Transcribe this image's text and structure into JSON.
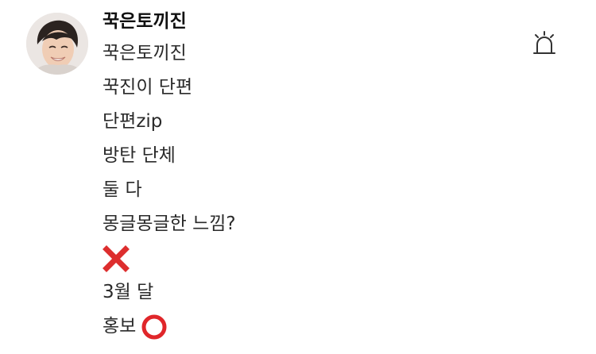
{
  "comment": {
    "username": "꾹은토끼진",
    "lines": [
      {
        "text": "꾹은토끼진"
      },
      {
        "text": "꾹진이 단편"
      },
      {
        "text": "단편zip"
      },
      {
        "text": "방탄 단체"
      },
      {
        "text": "둘 다"
      },
      {
        "text": "몽글몽글한 느낌?"
      },
      {
        "text": "",
        "icon": "cross-mark-icon"
      },
      {
        "text": "3월 달"
      },
      {
        "text": "홍보",
        "icon": "hollow-red-circle-icon"
      }
    ]
  },
  "icons": {
    "report": "siren-report-icon",
    "avatar": "profile-avatar"
  },
  "colors": {
    "cross": "#dd2e2e",
    "circle": "#e0262a",
    "icon_stroke": "#333333"
  }
}
